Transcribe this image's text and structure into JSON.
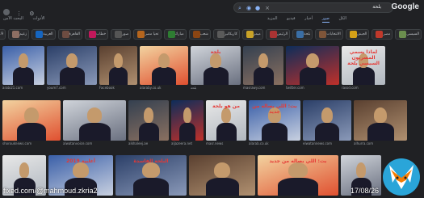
{
  "header": {
    "logo": "Google",
    "search_query": "بلحة",
    "tabs": [
      "الكل",
      "صور",
      "أخبار",
      "فيديو",
      "المزيد"
    ],
    "left_tools": [
      "الأدوات",
      "البحث الآمن"
    ]
  },
  "chips": [
    "السيسي",
    "مصر",
    "الجيش",
    "الانتخابات",
    "بلحة",
    "الرئيس",
    "ميمز",
    "كاريكاتير",
    "شعب",
    "مبارك",
    "تحيا مصر",
    "صور",
    "خطاب",
    "القاهرة",
    "العربية",
    "زعيم",
    "2019",
    "النيل",
    "ميدان",
    "مرسي",
    "إخوان"
  ],
  "chip_colors": [
    "#6b8e4e",
    "#c0392b",
    "#d4a017",
    "#7f5539",
    "#3a6ea5",
    "#a33",
    "#c9a227",
    "#5a5a5a",
    "#8b4513",
    "#2e7d32",
    "#b5651d",
    "#555",
    "#c2185b",
    "#6d4c41",
    "#1565c0",
    "#8d6e63",
    "#e53935",
    "#4e342e",
    "#9e9e9e",
    "#455a64",
    "#795548"
  ],
  "results_row1": [
    {
      "caption": "arabi21.com",
      "text": ""
    },
    {
      "caption": "youm7.com",
      "text": ""
    },
    {
      "caption": "Facebook",
      "text": ""
    },
    {
      "caption": "alaraby.co.uk",
      "text": ""
    },
    {
      "caption": "بلحة",
      "text": "بلحة"
    },
    {
      "caption": "masrawy.com",
      "text": ""
    },
    {
      "caption": "twitter.com",
      "text": ""
    },
    {
      "caption": "rassd.com",
      "text": "لماذا يسمي المصريون السيسي بلحة"
    }
  ],
  "results_row2": [
    {
      "caption": "shorouknews.com",
      "text": ""
    },
    {
      "caption": "alwatanvoice.com",
      "text": ""
    },
    {
      "caption": "alkhaleej.ae",
      "text": ""
    },
    {
      "caption": "aljazeera.net",
      "text": ""
    },
    {
      "caption": "masr.news",
      "text": "من هو بلحة"
    },
    {
      "caption": "alarab.co.uk",
      "text": "بت: اللي بصاله من جديد"
    },
    {
      "caption": "elwatannews.com",
      "text": ""
    },
    {
      "caption": "alhurra.com",
      "text": ""
    }
  ],
  "results_row3": [
    {
      "caption": "",
      "text": ""
    },
    {
      "caption": "",
      "text": "2019 أغلبية"
    },
    {
      "caption": "",
      "text": "البلحة الفاسدة"
    },
    {
      "caption": "",
      "text": ""
    },
    {
      "caption": "",
      "text": "بت: اللي بصاله من جديد"
    },
    {
      "caption": "",
      "text": ""
    }
  ],
  "watermark": "fixed.com/@mahmoud.zkria2",
  "date": "17/08/26"
}
